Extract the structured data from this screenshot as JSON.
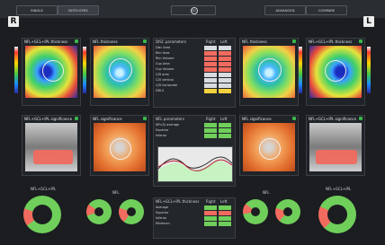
{
  "header": {
    "tabs": [
      "SINGLE",
      "BOTH EYES",
      "3D",
      "ADVANCED",
      "COMPARE"
    ],
    "active_tab": "BOTH EYES"
  },
  "eyes": {
    "left_badge": "R",
    "right_badge": "L"
  },
  "maps": {
    "nfl_gcl_ipl_thickness": "NFL+GCL+IPL thickness",
    "nfl_thickness": "NFL thickness",
    "nfl_gcl_ipl_significance": "NFL+GCL+IPL significance",
    "nfl_significance": "NFL significance"
  },
  "center_top": {
    "title": "DISC parameters",
    "col_right": "Right",
    "col_left": "Left",
    "rows": [
      {
        "label": "Disc Area",
        "r": "",
        "l": ""
      },
      {
        "label": "Rim Area",
        "r": "",
        "l": ""
      },
      {
        "label": "Rim Volume",
        "r": "",
        "l": ""
      },
      {
        "label": "Cup Area",
        "r": "",
        "l": ""
      },
      {
        "label": "Cup Volume",
        "r": "",
        "l": ""
      },
      {
        "label": "C/D area",
        "r": "",
        "l": ""
      },
      {
        "label": "C/D vertical",
        "r": "",
        "l": ""
      },
      {
        "label": "C/D horizontal",
        "r": "",
        "l": ""
      },
      {
        "label": "DDLS",
        "r": "",
        "l": ""
      }
    ]
  },
  "center_mid": {
    "title": "NFL parameters",
    "col_right": "Right",
    "col_left": "Left",
    "rows": [
      {
        "label": "NFL(S) average",
        "r": "",
        "l": ""
      },
      {
        "label": "Superior",
        "r": "",
        "l": ""
      },
      {
        "label": "Inferior",
        "r": "",
        "l": ""
      }
    ]
  },
  "center_bottom": {
    "title": "NFL+GCL+IPL thickness",
    "col_right": "Right",
    "col_left": "Left",
    "rows": [
      {
        "label": "Average",
        "r": "",
        "l": ""
      },
      {
        "label": "Superior",
        "r": "",
        "l": ""
      },
      {
        "label": "Inferior",
        "r": "",
        "l": ""
      },
      {
        "label": "Minimum",
        "r": "",
        "l": ""
      }
    ]
  },
  "bottom": {
    "left_donut_title": "NFL+GCL+IPL",
    "mid_left_title": "NFL",
    "mid_right_title": "NFL",
    "right_donut_title": "NFL+GCL+IPL"
  },
  "colors": {
    "bg": "#1b1d20",
    "panel": "#202328",
    "accent_green": "#39b54a",
    "accent_red": "#f26b5f",
    "accent_yellow": "#f4d23e"
  },
  "icons": [
    "settings-icon",
    "check-icon"
  ]
}
